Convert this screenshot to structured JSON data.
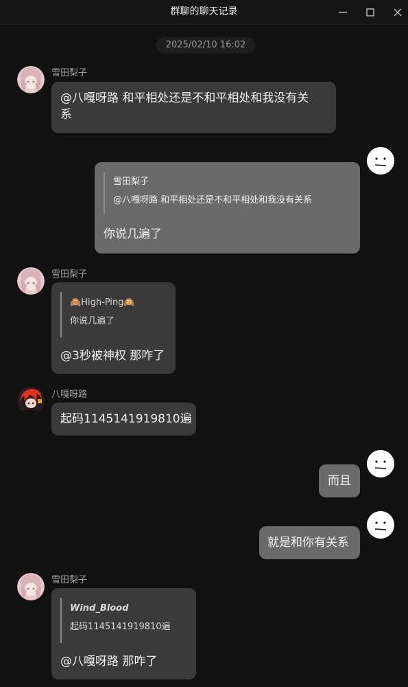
{
  "window": {
    "title": "群聊的聊天记录",
    "icons": {
      "minimize": "minimize-icon",
      "maximize": "maximize-icon",
      "close": "close-icon"
    }
  },
  "timestamp": "2025/02/10 16:02",
  "colors": {
    "background": "#111111",
    "bubble_other": "#3a3a3a",
    "bubble_self": "#6a6a6a",
    "sender_name": "#9c9c9c"
  },
  "messages": [
    {
      "side": "left",
      "sender": "雪田梨子",
      "avatar": "anime-girl-avatar",
      "text": "@八嘎呀路 和平相处还是不和平相处和我没有关\n系"
    },
    {
      "side": "right",
      "avatar": "face-emoji-avatar",
      "quote": {
        "name": "雪田梨子",
        "text": "@八嘎呀路 和平相处还是不和平相处和我没有关系"
      },
      "text": "你说几遍了"
    },
    {
      "side": "left",
      "sender": "雪田梨子",
      "avatar": "anime-girl-avatar",
      "quote": {
        "name": "🙈High-Ping🙉",
        "text": "你说几遍了"
      },
      "text": "@3秒被神权 那咋了"
    },
    {
      "side": "left",
      "sender": "八嘎呀路",
      "avatar": "red-hair-character-avatar",
      "text": "起码1145141919810遍"
    },
    {
      "side": "right",
      "avatar": "face-emoji-avatar",
      "text": "而且"
    },
    {
      "side": "right",
      "avatar": "face-emoji-avatar",
      "text": "就是和你有关系"
    },
    {
      "side": "left",
      "sender": "雪田梨子",
      "avatar": "anime-girl-avatar",
      "quote": {
        "name": "Wind_Blood",
        "text": "起码1145141919810遍"
      },
      "text": "@八嘎呀路 那咋了"
    }
  ]
}
